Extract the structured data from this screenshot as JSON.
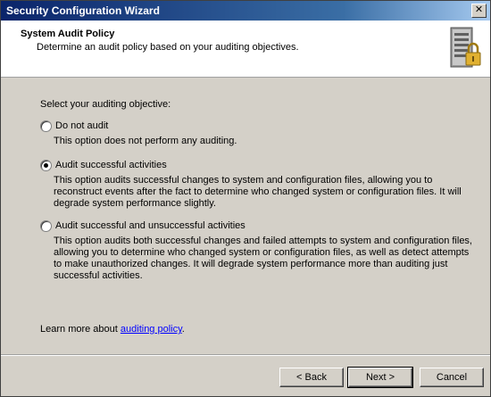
{
  "window": {
    "title": "Security Configuration Wizard",
    "close_glyph": "✕"
  },
  "header": {
    "title": "System Audit Policy",
    "subtitle": "Determine an audit policy based on your auditing objectives.",
    "icon": "server-lock-icon"
  },
  "main": {
    "prompt": "Select your auditing objective:",
    "options": [
      {
        "label": "Do not audit",
        "checked": false,
        "description": "This option does not perform any auditing."
      },
      {
        "label": "Audit successful activities",
        "checked": true,
        "description": "This option audits successful changes to system and configuration files, allowing you to reconstruct events after the fact to determine who changed system or configuration files. It will degrade system performance slightly."
      },
      {
        "label": "Audit successful and unsuccessful activities",
        "checked": false,
        "description": "This option audits both successful changes and failed attempts to system and configuration files, allowing you to determine who changed system or configuration files, as well as detect attempts to make unauthorized changes. It will degrade system performance more than auditing just successful activities."
      }
    ],
    "learn_prefix": "Learn more about ",
    "learn_link": "auditing policy",
    "learn_suffix": "."
  },
  "footer": {
    "back_label": "< Back",
    "next_label": "Next >",
    "cancel_label": "Cancel"
  },
  "colors": {
    "title_start": "#0a246a",
    "dialog_bg": "#d4d0c8",
    "link": "#0000ff"
  }
}
